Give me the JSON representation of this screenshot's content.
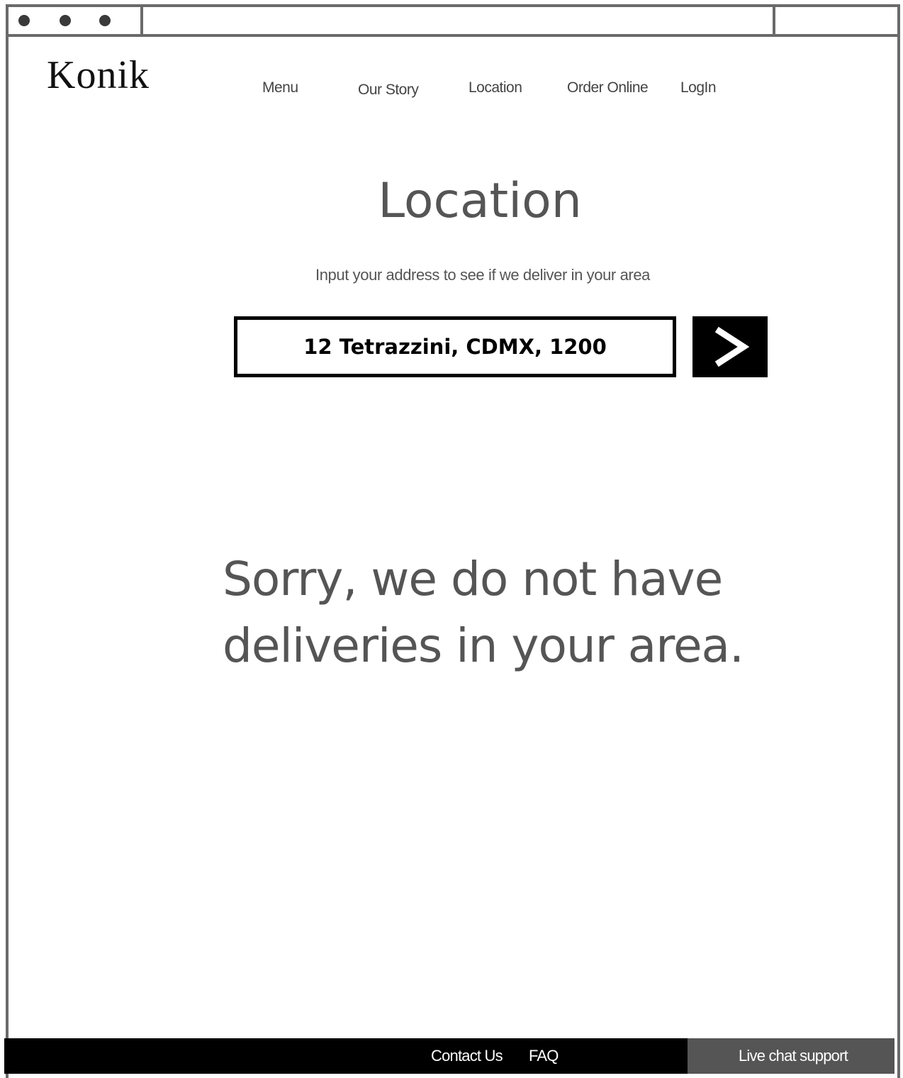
{
  "brand": {
    "logo": "Konik"
  },
  "nav": {
    "items": [
      {
        "label": "Menu"
      },
      {
        "label": "Our Story"
      },
      {
        "label": "Location"
      },
      {
        "label": "Order Online"
      },
      {
        "label": "LogIn"
      }
    ]
  },
  "main": {
    "title": "Location",
    "subtitle": "Input your address to see if we deliver in your area",
    "address_value": "12 Tetrazzini, CDMX, 1200",
    "submit_icon": "chevron-right-icon",
    "message_line1": "Sorry, we do not have",
    "message_line2": "deliveries in your area."
  },
  "footer": {
    "contact": "Contact Us",
    "faq": "FAQ",
    "live_chat": "Live chat support"
  },
  "colors": {
    "text_gray": "#555555",
    "footer_bg": "#000000",
    "live_chat_bg": "#555555"
  }
}
